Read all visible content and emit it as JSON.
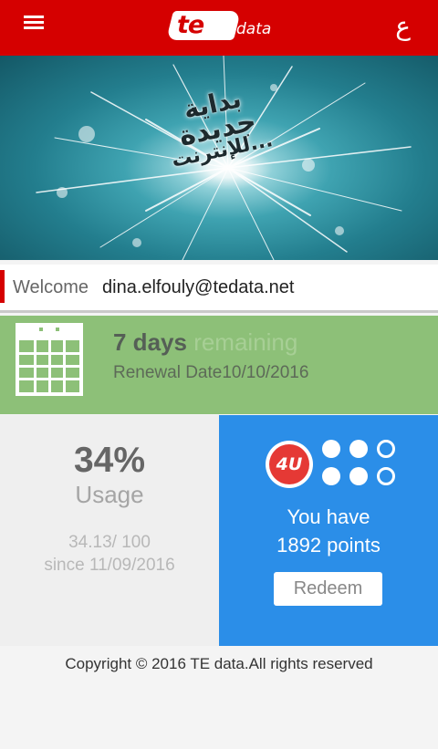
{
  "header": {
    "logo_te": "te",
    "logo_data": "data",
    "language_toggle": "ع"
  },
  "banner": {
    "line1": "بداية",
    "line2": "جديدة",
    "line3": "للإنترنت..."
  },
  "welcome": {
    "label": "Welcome",
    "email": "dina.elfouly@tedata.net"
  },
  "plan": {
    "days_count": "7 days",
    "days_word": "remaining",
    "renewal": "Renewal Date10/10/2016"
  },
  "usage": {
    "percent": "34%",
    "label": "Usage",
    "amount": "34.13/ 100",
    "since": "since 11/09/2016"
  },
  "points": {
    "badge": "4U",
    "line1": "You have",
    "line2": "1892  points",
    "redeem_label": "Redeem"
  },
  "footer": {
    "copyright": "Copyright © 2016 TE data.All rights reserved"
  },
  "colors": {
    "header_red": "#d50000",
    "plan_green": "#8dc078",
    "points_blue": "#2b8ee8"
  }
}
